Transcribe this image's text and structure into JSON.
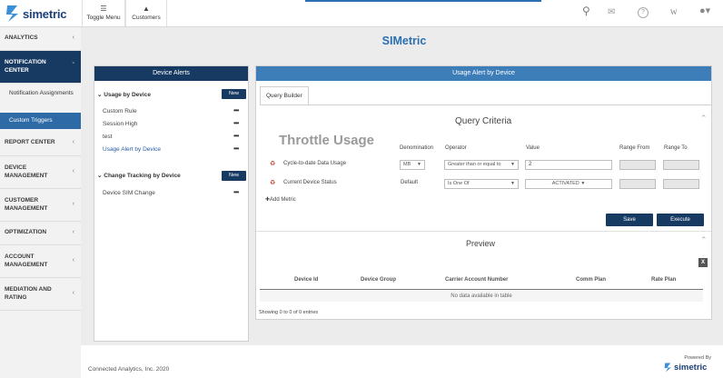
{
  "brand": {
    "name": "simetric",
    "accent": "#2a6fb0",
    "navy": "#173a63"
  },
  "toolbar": {
    "toggle_menu": "Toggle Menu",
    "customers": "Customers",
    "w_label": "W"
  },
  "sidebar": {
    "items": [
      {
        "label": "ANALYTICS"
      },
      {
        "label": "NOTIFICATION CENTER"
      },
      {
        "label": "REPORT CENTER"
      },
      {
        "label": "DEVICE MANAGEMENT"
      },
      {
        "label": "CUSTOMER MANAGEMENT"
      },
      {
        "label": "OPTIMIZATION"
      },
      {
        "label": "ACCOUNT MANAGEMENT"
      },
      {
        "label": "MEDIATION AND RATING"
      }
    ],
    "subitems": [
      {
        "label": "Notification Assignments"
      },
      {
        "label": "Custom Triggers"
      }
    ]
  },
  "page": {
    "title": "SIMetric"
  },
  "alerts": {
    "title": "Device Alerts",
    "new_label": "New",
    "usage": {
      "title": "Usage by Device",
      "items": [
        {
          "label": "Custom Rule"
        },
        {
          "label": "Session High"
        },
        {
          "label": "test"
        },
        {
          "label": "Usage Alert by Device"
        }
      ]
    },
    "change": {
      "title": "Change Tracking by Device",
      "items": [
        {
          "label": "Device SIM Change"
        }
      ]
    },
    "dots": "•••"
  },
  "usage_panel": {
    "title": "Usage Alert by Device",
    "tab": "Query Builder",
    "criteria_title": "Query Criteria",
    "heading": "Throttle Usage",
    "columns": {
      "denomination": "Denomination",
      "operator": "Operator",
      "value": "Value",
      "range_from": "Range From",
      "range_to": "Range To"
    },
    "rows": [
      {
        "label": "Cycle-to-date Data Usage",
        "denomination": "MB",
        "operator": "Greater than or equal to",
        "value": "2"
      },
      {
        "label": "Current Device Status",
        "denomination": "Default",
        "operator": "Is One Of",
        "value": "ACTIVATED"
      }
    ],
    "add_metric": "Add Metric",
    "save": "Save",
    "execute": "Execute"
  },
  "preview": {
    "title": "Preview",
    "columns": [
      "Device Id",
      "Device Group",
      "Carrier Account Number",
      "Comm Plan",
      "Rate Plan"
    ],
    "empty": "No data available in table",
    "showing": "Showing 0 to 0 of 0 entries",
    "export_icon_letter": "X"
  },
  "footer": {
    "copyright": "Connected Analytics, Inc. 2020",
    "powered_by": "Powered By",
    "logo_text": "simetric"
  }
}
